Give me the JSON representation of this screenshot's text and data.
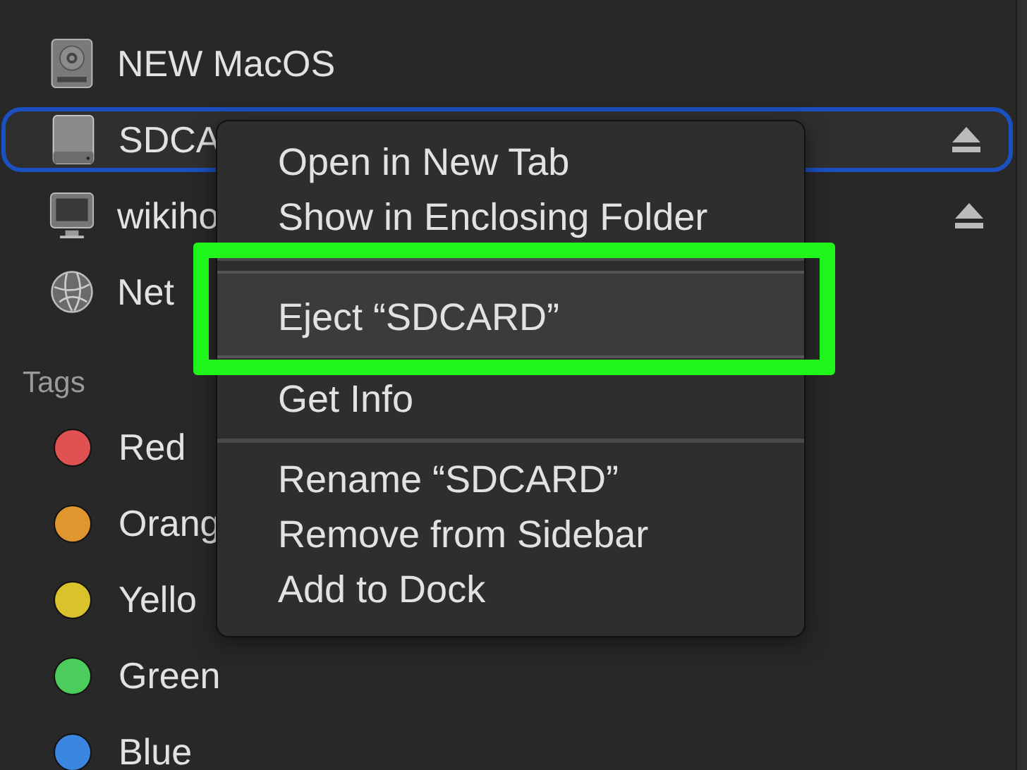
{
  "sidebar": {
    "locations": [
      {
        "label": "NEW MacOS",
        "kind": "disk",
        "selected": false,
        "ejectable": false
      },
      {
        "label": "SDCA",
        "kind": "drive",
        "selected": true,
        "ejectable": true
      },
      {
        "label": "wikiho",
        "kind": "monitor",
        "selected": false,
        "ejectable": true
      },
      {
        "label": "Net",
        "kind": "network",
        "selected": false,
        "ejectable": false
      }
    ],
    "tags_header": "Tags",
    "tags": [
      {
        "label": "Red",
        "color": "#e05252"
      },
      {
        "label": "Orang",
        "color": "#e0962e"
      },
      {
        "label": "Yello",
        "color": "#d9c22c"
      },
      {
        "label": "Green",
        "color": "#4ccc5a"
      },
      {
        "label": "Blue",
        "color": "#3a86e0"
      }
    ]
  },
  "context_menu": {
    "items": [
      {
        "kind": "item",
        "label": "Open in New Tab",
        "highlighted": false
      },
      {
        "kind": "item",
        "label": "Show in Enclosing Folder",
        "highlighted": false
      },
      {
        "kind": "separator"
      },
      {
        "kind": "item",
        "label": "Eject “SDCARD”",
        "highlighted": true
      },
      {
        "kind": "item",
        "label": "Get Info",
        "highlighted": false
      },
      {
        "kind": "separator"
      },
      {
        "kind": "item",
        "label": "Rename “SDCARD”",
        "highlighted": false
      },
      {
        "kind": "item",
        "label": "Remove from Sidebar",
        "highlighted": false
      },
      {
        "kind": "item",
        "label": "Add to Dock",
        "highlighted": false
      }
    ]
  }
}
